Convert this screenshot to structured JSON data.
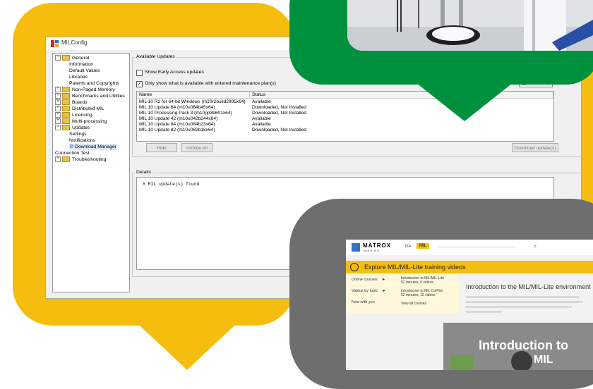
{
  "milconfig": {
    "title": "MILConfig",
    "tree": [
      {
        "label": "General",
        "level": 0,
        "expander": "−",
        "folder": true
      },
      {
        "label": "Information",
        "level": 1
      },
      {
        "label": "Default Values",
        "level": 1
      },
      {
        "label": "Libraries",
        "level": 1
      },
      {
        "label": "Patents and Copyrights",
        "level": 1
      },
      {
        "label": "Non-Paged Memory",
        "level": 0,
        "expander": "+",
        "folder": true
      },
      {
        "label": "Benchmarks and Utilities",
        "level": 0,
        "expander": "+",
        "folder": true
      },
      {
        "label": "Boards",
        "level": 0,
        "expander": "+",
        "folder": true
      },
      {
        "label": "Distributed MIL",
        "level": 0,
        "expander": "+",
        "folder": true
      },
      {
        "label": "Licensing",
        "level": 0,
        "expander": "+",
        "folder": true
      },
      {
        "label": "Multi-processing",
        "level": 0,
        "expander": "+",
        "folder": true
      },
      {
        "label": "Updates",
        "level": 0,
        "expander": "−",
        "folder": true
      },
      {
        "label": "Settings",
        "level": 1
      },
      {
        "label": "Notifications",
        "level": 1
      },
      {
        "label": "Download Manager",
        "level": 1,
        "selected": true
      },
      {
        "label": "Connection Test",
        "level": 0
      },
      {
        "label": "Troubleshooting",
        "level": 0,
        "expander": "+",
        "folder": true
      }
    ],
    "available_updates_label": "Available Updates",
    "early_access_label": "Show Early Access updates",
    "early_access_checked": false,
    "maintenance_label": "Only show what is available with entered maintenance plan(s)",
    "maintenance_checked": true,
    "dropdown_value": "all",
    "columns": [
      "Name",
      "Status"
    ],
    "rows": [
      [
        "MIL 10 R2 for 64-bit Windows (m10r2build2995x64)",
        "Available"
      ],
      [
        "MIL 10 Update 64 (m10u064b45x64)",
        "Downloaded, Not Installed"
      ],
      [
        "MIL 10 Processing Pack 3 (m10pp3b601x64)",
        "Downloaded, Not Installed"
      ],
      [
        "MIL 10 Update 42 (m10u042b244x64)",
        "Available"
      ],
      [
        "MIL 10 Update 84 (m10u084b23x64)",
        "Available"
      ],
      [
        "MIL 10 Update 82 (m10u082b18x64)",
        "Downloaded, Not Installed"
      ]
    ],
    "hide_label": "Hide",
    "unhide_label": "Unhide All",
    "download_label": "Download update(s)",
    "details_label": "Details",
    "details_text": "6 MIL update(s) found"
  },
  "website": {
    "logo": "MATROX",
    "logo_sub": "IMAGING",
    "nav_da": "DA",
    "nav_mil": "MIL",
    "banner": "Explore MIL/MIL-Lite training videos",
    "menu": [
      {
        "label": "Online courses",
        "arrow": "►"
      },
      {
        "label": "Videos by topic",
        "arrow": "►"
      },
      {
        "label": "New with you",
        "arrow": ""
      }
    ],
    "submenu": [
      {
        "title": "Introduction to MIL/MIL-Lite",
        "meta": "52 minutes, 9 videos"
      },
      {
        "title": "Introduction to MIL CoPilot",
        "meta": "52 minutes, 10 videos"
      },
      {
        "title": "View all courses",
        "meta": ""
      }
    ],
    "heading": "Introduction to the MIL/MIL-Lite environment",
    "hero_text": "Introduction to",
    "hero_sub": "MIL"
  },
  "colors": {
    "yellow": "#f5be0f",
    "green": "#00913e",
    "gray": "#6e6e6e",
    "banner": "#f5be0f"
  }
}
